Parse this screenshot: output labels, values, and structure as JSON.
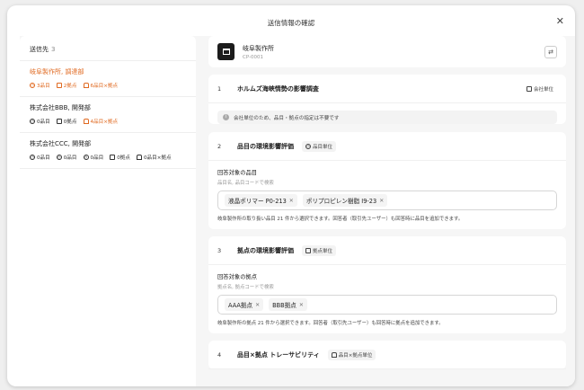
{
  "title": "送信情報の確認",
  "recipients": {
    "label": "送信先",
    "count": "3",
    "items": [
      {
        "name": "岐阜製作所, 調達部",
        "tags": [
          {
            "icon": "clock-icon",
            "text": "3品目"
          },
          {
            "icon": "building-icon",
            "text": "2拠点"
          },
          {
            "icon": "link-icon",
            "text": "6品目×拠点"
          }
        ]
      },
      {
        "name": "株式会社BBB, 開発部",
        "tags": [
          {
            "icon": "clock-icon",
            "text": "0品目"
          },
          {
            "icon": "building-icon",
            "text": "0拠点"
          },
          {
            "icon": "link-icon",
            "text": "4品目×拠点"
          }
        ]
      },
      {
        "name": "株式会社CCC, 開発部",
        "tags": [
          {
            "icon": "clock-icon",
            "text": "0品目"
          },
          {
            "icon": "clock-icon",
            "text": "0品目"
          },
          {
            "icon": "clock-icon",
            "text": "0品目"
          },
          {
            "icon": "building-icon",
            "text": "0拠点"
          },
          {
            "icon": "link-icon",
            "text": "0品目×拠点"
          }
        ]
      }
    ]
  },
  "company": {
    "name": "岐阜製作所",
    "code": "CP-0001"
  },
  "sections": {
    "s1": {
      "num": "1",
      "title": "ホルムズ海峡情勢の影響調査",
      "unit": "会社単位",
      "note": "会社単位のため、品目・拠点の指定は不要です"
    },
    "s2": {
      "num": "2",
      "title": "品目の環境影響評価",
      "unit": "品目単位",
      "field_label": "回答対象の品目",
      "field_sub": "品目名, 品目コードで検索",
      "chips": [
        "液晶ポリマー P0-213",
        "ポリプロピレン樹脂 I9-23"
      ],
      "help": "岐阜製作所の取り扱い品目 21 件から選択できます。回答者（取引先ユーザー）も回答時に品目を追加できます。"
    },
    "s3": {
      "num": "3",
      "title": "拠点の環境影響評価",
      "unit": "拠点単位",
      "field_label": "回答対象の拠点",
      "field_sub": "拠点名, 拠点コードで検索",
      "chips": [
        "AAA拠点",
        "BBB拠点"
      ],
      "help": "岐阜製作所の拠点 21 件から選択できます。回答者（取引先ユーザー）も回答時に拠点を追加できます。"
    },
    "s4": {
      "num": "4",
      "title": "品目×拠点 トレーサビリティ",
      "unit": "品目×拠点単位"
    }
  },
  "colors": {
    "accent": "#e06920"
  }
}
